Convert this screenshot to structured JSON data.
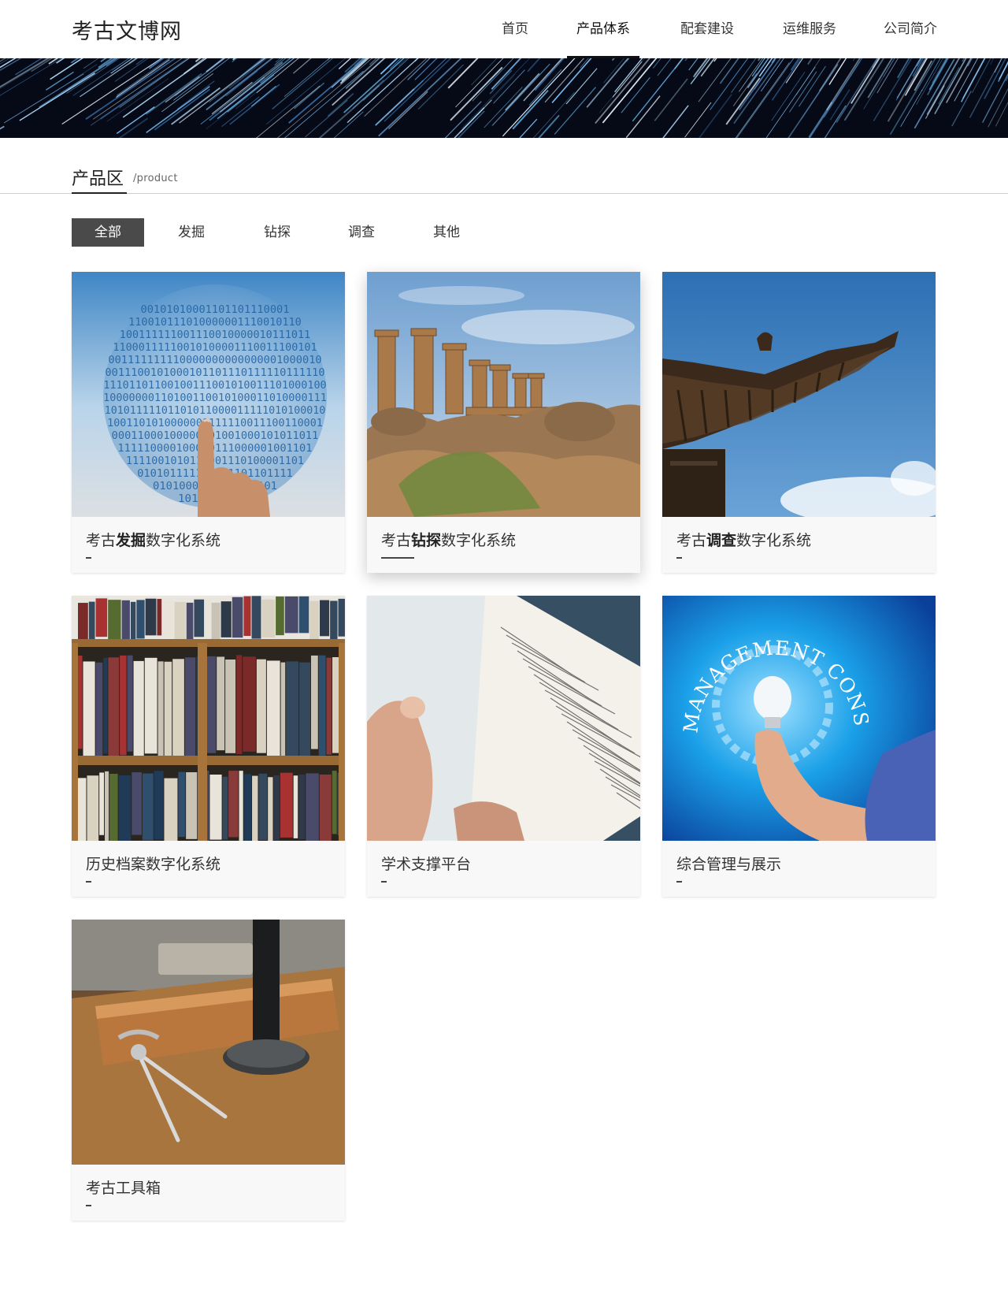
{
  "site": {
    "logo": "考古文博网"
  },
  "nav": {
    "items": [
      {
        "label": "首页",
        "active": false
      },
      {
        "label": "产品体系",
        "active": true
      },
      {
        "label": "配套建设",
        "active": false
      },
      {
        "label": "运维服务",
        "active": false
      },
      {
        "label": "公司简介",
        "active": false
      }
    ]
  },
  "section": {
    "title": "产品区",
    "subtitle": "/product"
  },
  "filters": [
    {
      "label": "全部",
      "active": true
    },
    {
      "label": "发掘",
      "active": false
    },
    {
      "label": "钻探",
      "active": false
    },
    {
      "label": "调查",
      "active": false
    },
    {
      "label": "其他",
      "active": false
    }
  ],
  "products": [
    {
      "pre": "考古",
      "key": "发掘",
      "post": "数字化系统",
      "image": "binary-globe-finger"
    },
    {
      "pre": "考古",
      "key": "钻探",
      "post": "数字化系统",
      "image": "ancient-columns-ruins"
    },
    {
      "pre": "考古",
      "key": "调查",
      "post": "数字化系统",
      "image": "chinese-roof-eave"
    },
    {
      "pre": "历史档案数字化系统",
      "key": "",
      "post": "",
      "image": "bookshelf"
    },
    {
      "pre": "学术支撑平台",
      "key": "",
      "post": "",
      "image": "open-book"
    },
    {
      "pre": "综合管理与展示",
      "key": "",
      "post": "",
      "image": "lightbulb-management-consulting"
    },
    {
      "pre": "考古工具箱",
      "key": "",
      "post": "",
      "image": "compass-on-desk"
    }
  ],
  "image_text": {
    "consulting": "MANAGEMENT CONSULTING"
  },
  "colors": {
    "accent": "#4a4a4a",
    "underline": "#111111"
  }
}
